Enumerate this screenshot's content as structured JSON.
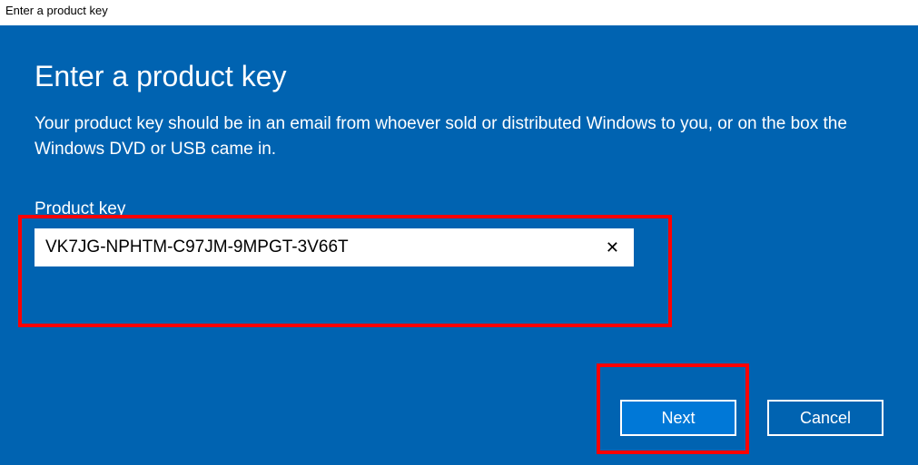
{
  "titleBar": "Enter a product key",
  "heading": "Enter a product key",
  "description": "Your product key should be in an email from whoever sold or distributed Windows to you, or on the box the Windows DVD or USB came in.",
  "field": {
    "label": "Product key",
    "value": "VK7JG-NPHTM-C97JM-9MPGT-3V66T",
    "clear": "✕"
  },
  "buttons": {
    "next": "Next",
    "cancel": "Cancel"
  }
}
